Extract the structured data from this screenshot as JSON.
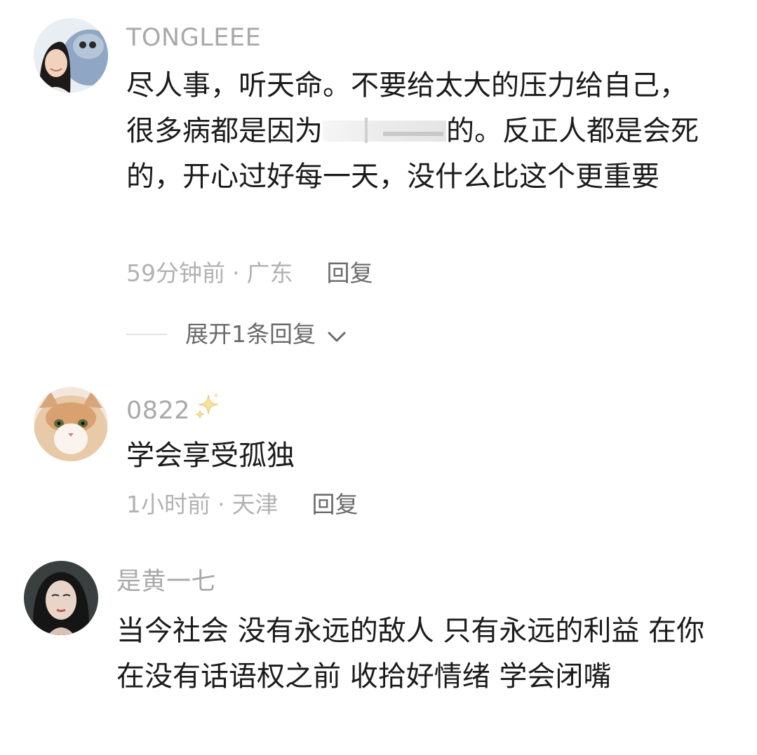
{
  "comments": [
    {
      "username": "TONGLEEE",
      "text_part1": "尽人事，听天命。不要给太大的压力给自己，很多病都是因为",
      "text_part2": "的。反正人都是会死的，开心过好每一天，没什么比这个更重要",
      "time": "59分钟前",
      "location": "广东",
      "reply_label": "回复",
      "expand_label": "展开1条回复"
    },
    {
      "username": "0822",
      "text": "学会享受孤独",
      "time": "1小时前",
      "location": "天津",
      "reply_label": "回复"
    },
    {
      "username": "是黄一七",
      "text": "当今社会 没有永远的敌人 只有永远的利益 在你在没有话语权之前 收拾好情绪 学会闭嘴"
    }
  ],
  "separator": "·",
  "icons": {
    "sparkle": "sparkle-icon",
    "chevron": "chevron-down-icon"
  },
  "colors": {
    "username": "#a9a9a9",
    "body": "#1b1b1b",
    "meta": "#b2b2b2",
    "reply": "#6a6a6a",
    "sparkle": "#f3d36a"
  }
}
